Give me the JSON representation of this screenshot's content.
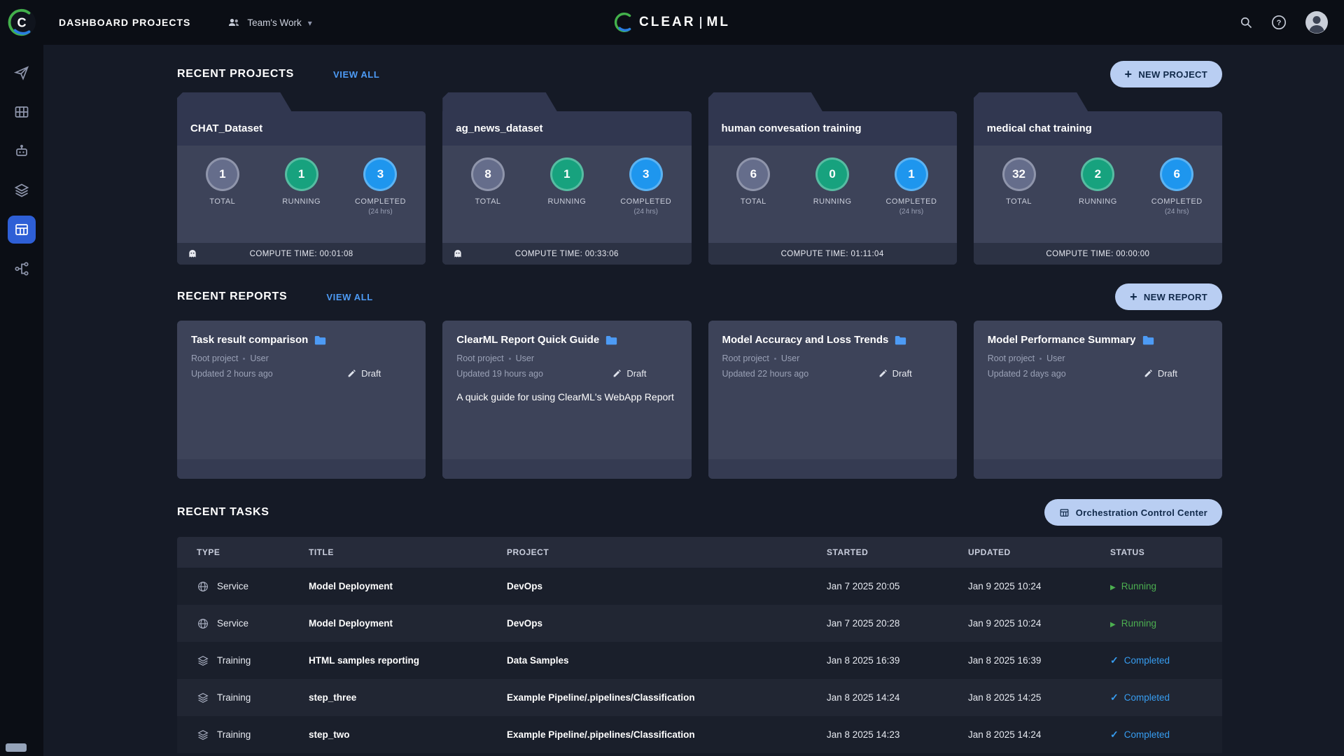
{
  "topbar": {
    "title": "DASHBOARD PROJECTS",
    "workspace": "Team's Work",
    "logo_primary": "CLEAR",
    "logo_secondary": "ML"
  },
  "sidebar": {
    "items": [
      "projects",
      "workers",
      "models",
      "datasets",
      "orchestration",
      "pipelines"
    ],
    "active_item": "orchestration"
  },
  "recent_projects": {
    "heading": "RECENT PROJECTS",
    "view_all": "VIEW ALL",
    "new_project_label": "NEW PROJECT",
    "stat_labels": {
      "total": "TOTAL",
      "running": "RUNNING",
      "completed": "COMPLETED",
      "window": "(24 hrs)"
    },
    "cards": [
      {
        "name": "CHAT_Dataset",
        "total": "1",
        "running": "1",
        "completed": "3",
        "compute_time": "COMPUTE TIME: 00:01:08",
        "has_ghost": true
      },
      {
        "name": "ag_news_dataset",
        "total": "8",
        "running": "1",
        "completed": "3",
        "compute_time": "COMPUTE TIME: 00:33:06",
        "has_ghost": true
      },
      {
        "name": "human convesation training",
        "total": "6",
        "running": "0",
        "completed": "1",
        "compute_time": "COMPUTE TIME: 01:11:04",
        "has_ghost": false
      },
      {
        "name": "medical chat training",
        "total": "32",
        "running": "2",
        "completed": "6",
        "compute_time": "COMPUTE TIME: 00:00:00",
        "has_ghost": false
      }
    ]
  },
  "recent_reports": {
    "heading": "RECENT REPORTS",
    "view_all": "VIEW ALL",
    "new_report_label": "NEW REPORT",
    "cards": [
      {
        "title": "Task result comparison",
        "project": "Root project",
        "author": "User",
        "updated": "Updated 2 hours ago",
        "status": "Draft",
        "description": ""
      },
      {
        "title": "ClearML Report Quick Guide",
        "project": "Root project",
        "author": "User",
        "updated": "Updated 19 hours ago",
        "status": "Draft",
        "description": "A quick guide for using ClearML's WebApp Report"
      },
      {
        "title": "Model Accuracy and Loss Trends",
        "project": "Root project",
        "author": "User",
        "updated": "Updated 22 hours ago",
        "status": "Draft",
        "description": ""
      },
      {
        "title": "Model Performance Summary",
        "project": "Root project",
        "author": "User",
        "updated": "Updated 2 days ago",
        "status": "Draft",
        "description": ""
      }
    ]
  },
  "recent_tasks": {
    "heading": "RECENT TASKS",
    "orchestration_button": "Orchestration Control Center",
    "columns": [
      "TYPE",
      "TITLE",
      "PROJECT",
      "STARTED",
      "UPDATED",
      "STATUS"
    ],
    "rows": [
      {
        "type": "Service",
        "title": "Model Deployment",
        "project": "DevOps",
        "started": "Jan 7 2025 20:05",
        "updated": "Jan 9 2025 10:24",
        "status": "Running"
      },
      {
        "type": "Service",
        "title": "Model Deployment",
        "project": "DevOps",
        "started": "Jan 7 2025 20:28",
        "updated": "Jan 9 2025 10:24",
        "status": "Running"
      },
      {
        "type": "Training",
        "title": "HTML samples reporting",
        "project": "Data Samples",
        "started": "Jan 8 2025 16:39",
        "updated": "Jan 8 2025 16:39",
        "status": "Completed"
      },
      {
        "type": "Training",
        "title": "step_three",
        "project": "Example Pipeline/.pipelines/Classification",
        "started": "Jan 8 2025 14:24",
        "updated": "Jan 8 2025 14:25",
        "status": "Completed"
      },
      {
        "type": "Training",
        "title": "step_two",
        "project": "Example Pipeline/.pipelines/Classification",
        "started": "Jan 8 2025 14:23",
        "updated": "Jan 8 2025 14:24",
        "status": "Completed"
      }
    ]
  },
  "colors": {
    "topbar_bg": "#0b0e15",
    "main_bg": "#151a26",
    "card_bg": "#3d4359",
    "accent_link_blue": "#4d9bf5",
    "button_bg": "#b9cef2",
    "total_gray": "#656d8b",
    "running_green": "#17a27e",
    "completed_blue": "#1e96ee",
    "status_running": "#4caf50",
    "status_completed": "#379df1",
    "sidebar_active_blue": "#2e5fd6"
  }
}
